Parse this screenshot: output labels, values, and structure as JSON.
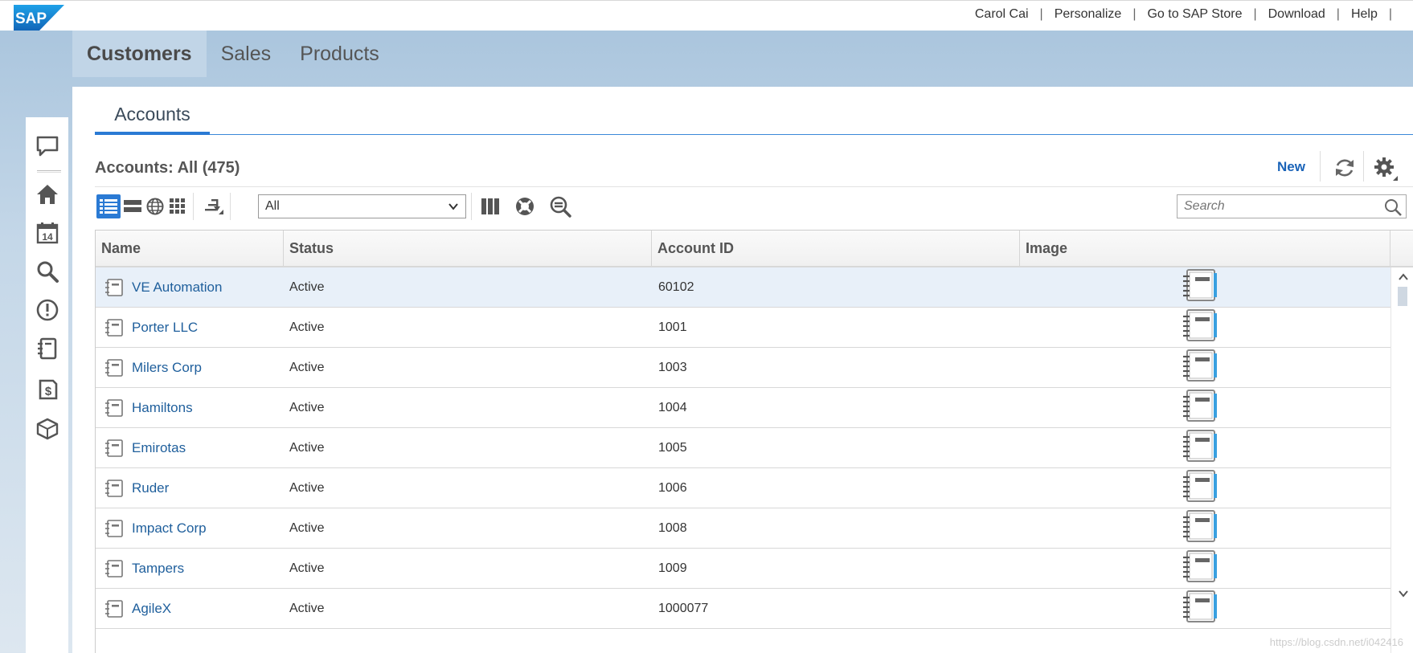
{
  "topbar": {
    "logo_text": "SAP",
    "links": [
      "Carol Cai",
      "Personalize",
      "Go to SAP Store",
      "Download",
      "Help"
    ],
    "separator": "|"
  },
  "nav": {
    "tabs": [
      "Customers",
      "Sales",
      "Products"
    ],
    "active": "Customers"
  },
  "sidebar": {
    "icons": [
      "chat-icon",
      "home-icon",
      "calendar-icon",
      "search-icon",
      "alert-icon",
      "notebook-icon",
      "invoice-icon",
      "product-box-icon"
    ],
    "calendar_day": "14"
  },
  "subtabs": {
    "active": "Accounts"
  },
  "list": {
    "title": "Accounts: All (475)",
    "new_label": "New"
  },
  "toolbar": {
    "filter_value": "All",
    "search_placeholder": "Search"
  },
  "table": {
    "columns": [
      "Name",
      "Status",
      "Account ID",
      "Image"
    ],
    "rows": [
      {
        "name": "VE Automation",
        "status": "Active",
        "account_id": "60102"
      },
      {
        "name": "Porter LLC",
        "status": "Active",
        "account_id": "1001"
      },
      {
        "name": "Milers Corp",
        "status": "Active",
        "account_id": "1003"
      },
      {
        "name": "Hamiltons",
        "status": "Active",
        "account_id": "1004"
      },
      {
        "name": "Emirotas",
        "status": "Active",
        "account_id": "1005"
      },
      {
        "name": "Ruder",
        "status": "Active",
        "account_id": "1006"
      },
      {
        "name": "Impact Corp",
        "status": "Active",
        "account_id": "1008"
      },
      {
        "name": "Tampers",
        "status": "Active",
        "account_id": "1009"
      },
      {
        "name": "AgileX",
        "status": "Active",
        "account_id": "1000077"
      }
    ]
  },
  "colors": {
    "accent": "#2a7ad4",
    "link": "#1f5f9c",
    "selected_row": "#e8f0f9"
  },
  "watermark": "https://blog.csdn.net/i042416"
}
